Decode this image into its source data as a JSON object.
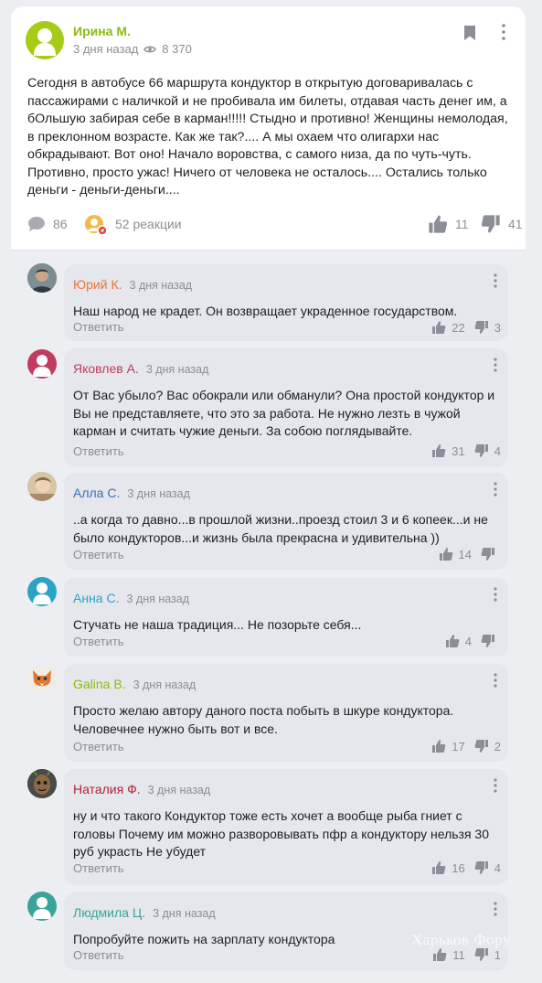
{
  "post": {
    "author": "Ирина М.",
    "time": "3 дня назад",
    "views": "8 370",
    "text": "Сегодня в автобусе 66 маршрута кондуктор в открытую договаривалась с пассажирами с наличкой и не пробивала им билеты, отдавая часть денег им, а бОльшую забирая себе в карман!!!!! Стыдно и противно! Женщины немолодая, в преклонном возрасте. Как же так?.... А мы охаем что олигархи нас обкрадывают. Вот оно! Начало воровства, с самого низа, да по чуть-чуть. Противно, просто ужас! Ничего от человека не осталось.... Остались только деньги - деньги-деньги....",
    "comments_count": "86",
    "reactions_label": "52 реакции",
    "likes": "11",
    "dislikes": "41",
    "author_color": "#8bbb10",
    "avatar_color": "#a6cc17"
  },
  "reply_label": "Ответить",
  "comments": [
    {
      "name": "Юрий К.",
      "time": "3 дня назад",
      "text": "Наш народ не крадет. Он возвращает украденное государством.",
      "likes": "22",
      "dislikes": "3",
      "name_color": "#e8743b",
      "avatar": "photo-man-icon"
    },
    {
      "name": "Яковлев А.",
      "time": "3 дня назад",
      "text": "От Вас убыло? Вас обокрали или обманули? Она простой кондуктор и Вы не представляете, что это за работа. Не нужно лезть в чужой карман и считать чужие деньги. За собою поглядывайте.",
      "likes": "31",
      "dislikes": "4",
      "name_color": "#c23b5e",
      "avatar": "user-silhouette-icon"
    },
    {
      "name": "Алла С.",
      "time": "3 дня назад",
      "text": "..а когда то давно...в прошлой жизни..проезд стоил 3 и 6 копеек...и не было кондукторов...и жизнь была прекрасна и удивительна ))",
      "likes": "14",
      "dislikes": "",
      "name_color": "#3a6fb0",
      "avatar": "photo-child-icon"
    },
    {
      "name": "Анна С.",
      "time": "3 дня назад",
      "text": "Стучать не наша традиция... Не позорьте себя...",
      "likes": "4",
      "dislikes": "",
      "name_color": "#2aa3c7",
      "avatar": "user-silhouette-icon"
    },
    {
      "name": "Galina B.",
      "time": "3 дня назад",
      "text": "Просто желаю автору даного поста побыть в шкуре кондуктора. Человечнее нужно быть вот и все.",
      "likes": "17",
      "dislikes": "2",
      "name_color": "#8bbb10",
      "avatar": "fox-icon"
    },
    {
      "name": "Наталия Ф.",
      "time": "3 дня назад",
      "text": "ну и что такого Кондуктор тоже есть хочет а вообще рыба гниет с головы Почему им можно разворовывать пфр а кондуктору нельзя 30 руб украсть Не убудет",
      "likes": "16",
      "dislikes": "4",
      "name_color": "#b2233a",
      "avatar": "groot-icon"
    },
    {
      "name": "Людмила Ц.",
      "time": "3 дня назад",
      "text": "Попробуйте пожить на зарплату кондуктора",
      "likes": "11",
      "dislikes": "1",
      "name_color": "#3aa39c",
      "avatar": "user-silhouette-icon"
    }
  ],
  "watermark": "Харьков Фору"
}
